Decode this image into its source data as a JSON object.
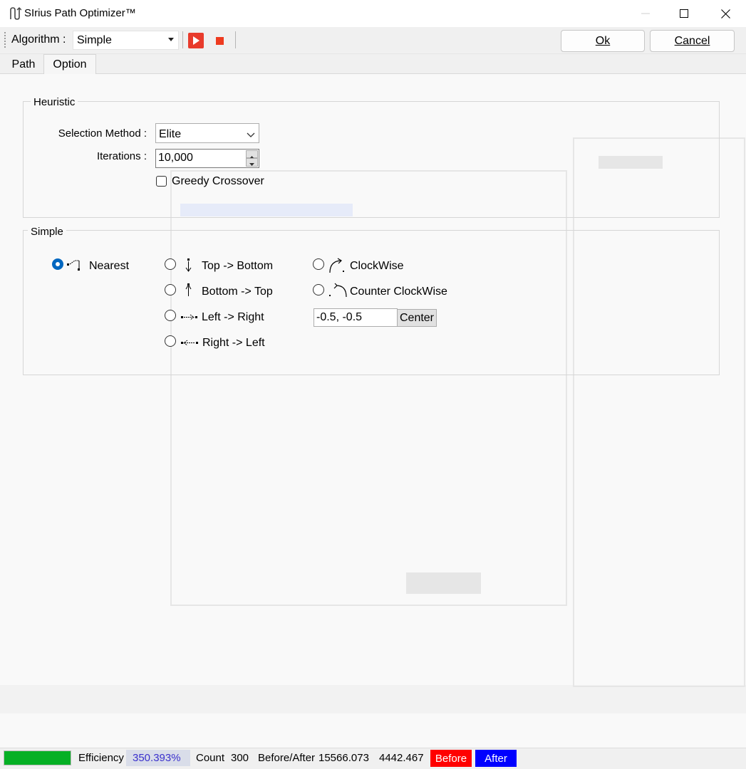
{
  "window": {
    "title": "SIrius Path Optimizer™"
  },
  "toolbar": {
    "algorithm_label": "Algorithm :",
    "algorithm_value": "Simple",
    "ok_label": "Ok",
    "cancel_label": "Cancel",
    "play_icon": "play-icon",
    "stop_icon": "stop-icon",
    "accent_color": "#e83b2c"
  },
  "tabs": [
    {
      "label": "Path",
      "active": false
    },
    {
      "label": "Option",
      "active": true
    }
  ],
  "heuristic": {
    "title": "Heuristic",
    "selection_method_label": "Selection Method :",
    "selection_method_value": "Elite",
    "iterations_label": "Iterations :",
    "iterations_value": "10,000",
    "greedy_crossover_label": "Greedy Crossover",
    "greedy_crossover_checked": false
  },
  "simple": {
    "title": "Simple",
    "options": [
      {
        "label": "Nearest",
        "selected": true,
        "icon": "nearest-icon"
      },
      {
        "label": "Top -> Bottom",
        "selected": false,
        "icon": "top-bottom-icon"
      },
      {
        "label": "Bottom -> Top",
        "selected": false,
        "icon": "bottom-top-icon"
      },
      {
        "label": "Left -> Right",
        "selected": false,
        "icon": "left-right-icon"
      },
      {
        "label": "Right -> Left",
        "selected": false,
        "icon": "right-left-icon"
      },
      {
        "label": "ClockWise",
        "selected": false,
        "icon": "clockwise-icon"
      },
      {
        "label": "Counter ClockWise",
        "selected": false,
        "icon": "counter-clockwise-icon"
      }
    ],
    "center_value": "-0.5, -0.5",
    "center_button_label": "Center"
  },
  "status": {
    "progress": 1.0,
    "progress_color": "#06b025",
    "efficiency_label": "Efficiency",
    "efficiency_value": "350.393%",
    "count_label": "Count",
    "count_value": "300",
    "before_after_label": "Before/After",
    "before_value": "15566.073",
    "after_value": "4442.467",
    "before_badge": "Before",
    "after_badge": "After",
    "before_color": "#ff0000",
    "after_color": "#0000ff"
  }
}
